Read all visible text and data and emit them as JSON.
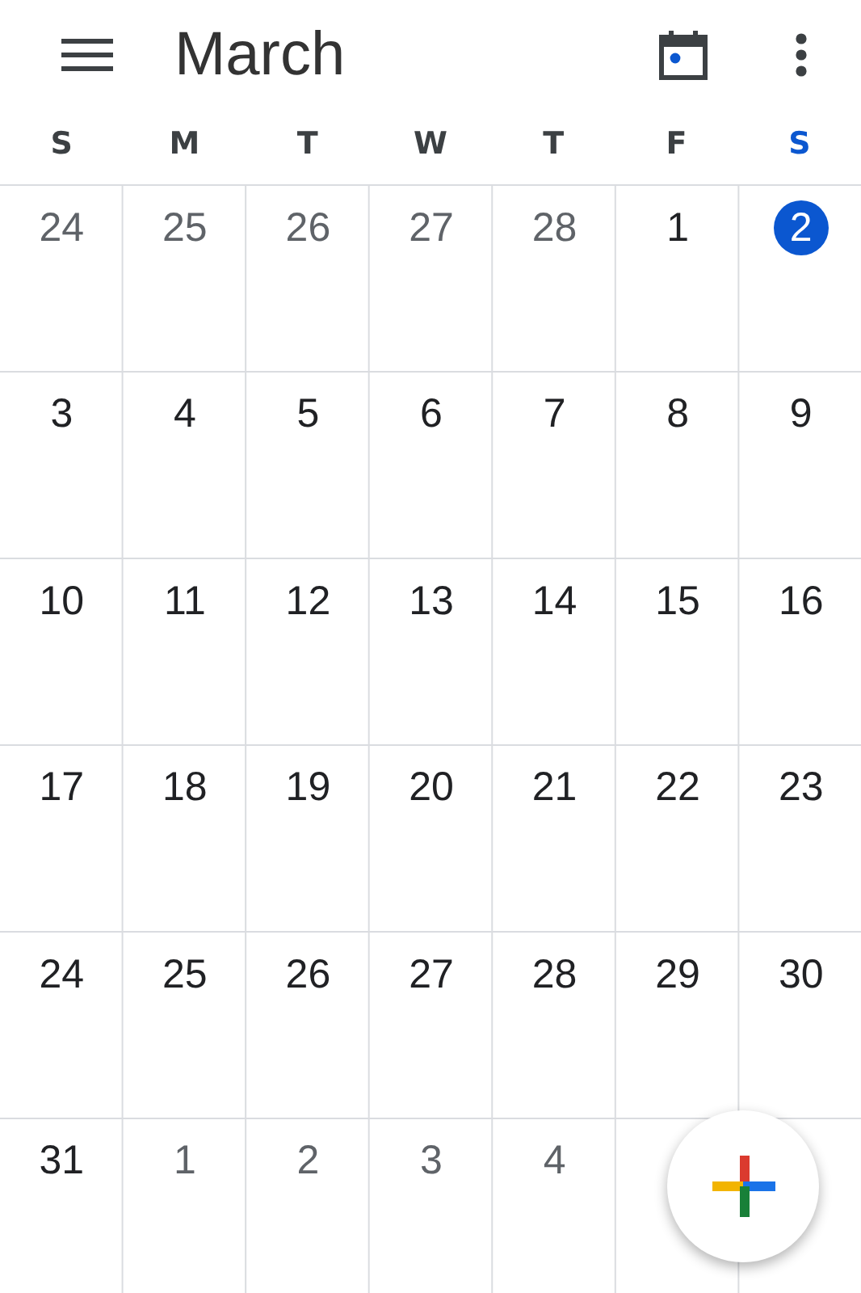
{
  "header": {
    "title": "March"
  },
  "weekdays": [
    {
      "label": "S",
      "selected": false
    },
    {
      "label": "M",
      "selected": false
    },
    {
      "label": "T",
      "selected": false
    },
    {
      "label": "W",
      "selected": false
    },
    {
      "label": "T",
      "selected": false
    },
    {
      "label": "F",
      "selected": false
    },
    {
      "label": "S",
      "selected": true
    }
  ],
  "weeks": [
    [
      {
        "day": "24",
        "in_month": false,
        "today": false
      },
      {
        "day": "25",
        "in_month": false,
        "today": false
      },
      {
        "day": "26",
        "in_month": false,
        "today": false
      },
      {
        "day": "27",
        "in_month": false,
        "today": false
      },
      {
        "day": "28",
        "in_month": false,
        "today": false
      },
      {
        "day": "1",
        "in_month": true,
        "today": false
      },
      {
        "day": "2",
        "in_month": true,
        "today": true
      }
    ],
    [
      {
        "day": "3",
        "in_month": true,
        "today": false
      },
      {
        "day": "4",
        "in_month": true,
        "today": false
      },
      {
        "day": "5",
        "in_month": true,
        "today": false
      },
      {
        "day": "6",
        "in_month": true,
        "today": false
      },
      {
        "day": "7",
        "in_month": true,
        "today": false
      },
      {
        "day": "8",
        "in_month": true,
        "today": false
      },
      {
        "day": "9",
        "in_month": true,
        "today": false
      }
    ],
    [
      {
        "day": "10",
        "in_month": true,
        "today": false
      },
      {
        "day": "11",
        "in_month": true,
        "today": false
      },
      {
        "day": "12",
        "in_month": true,
        "today": false
      },
      {
        "day": "13",
        "in_month": true,
        "today": false
      },
      {
        "day": "14",
        "in_month": true,
        "today": false
      },
      {
        "day": "15",
        "in_month": true,
        "today": false
      },
      {
        "day": "16",
        "in_month": true,
        "today": false
      }
    ],
    [
      {
        "day": "17",
        "in_month": true,
        "today": false
      },
      {
        "day": "18",
        "in_month": true,
        "today": false
      },
      {
        "day": "19",
        "in_month": true,
        "today": false
      },
      {
        "day": "20",
        "in_month": true,
        "today": false
      },
      {
        "day": "21",
        "in_month": true,
        "today": false
      },
      {
        "day": "22",
        "in_month": true,
        "today": false
      },
      {
        "day": "23",
        "in_month": true,
        "today": false
      }
    ],
    [
      {
        "day": "24",
        "in_month": true,
        "today": false
      },
      {
        "day": "25",
        "in_month": true,
        "today": false
      },
      {
        "day": "26",
        "in_month": true,
        "today": false
      },
      {
        "day": "27",
        "in_month": true,
        "today": false
      },
      {
        "day": "28",
        "in_month": true,
        "today": false
      },
      {
        "day": "29",
        "in_month": true,
        "today": false
      },
      {
        "day": "30",
        "in_month": true,
        "today": false
      }
    ],
    [
      {
        "day": "31",
        "in_month": true,
        "today": false
      },
      {
        "day": "1",
        "in_month": false,
        "today": false
      },
      {
        "day": "2",
        "in_month": false,
        "today": false
      },
      {
        "day": "3",
        "in_month": false,
        "today": false
      },
      {
        "day": "4",
        "in_month": false,
        "today": false
      }
    ]
  ]
}
